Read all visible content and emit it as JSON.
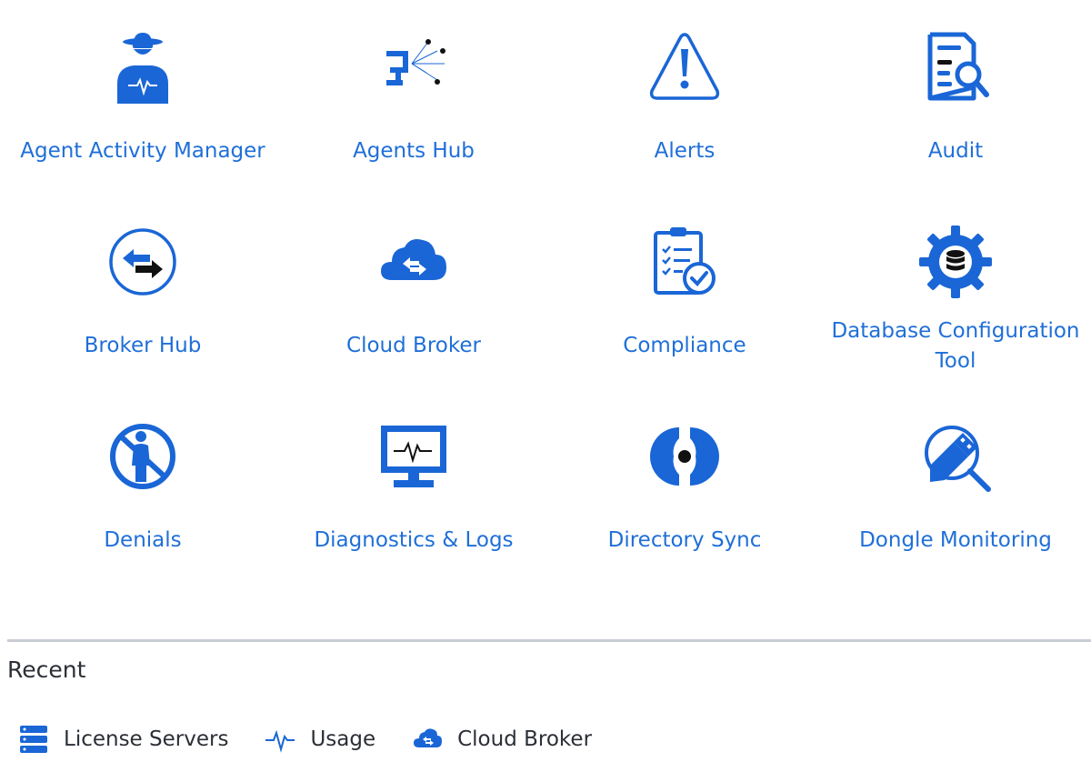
{
  "apps": [
    {
      "label": "Agent Activity Manager",
      "icon": "agent-spy-icon"
    },
    {
      "label": "Agents Hub",
      "icon": "network-monitor-icon"
    },
    {
      "label": "Alerts",
      "icon": "warning-triangle-icon"
    },
    {
      "label": "Audit",
      "icon": "document-search-icon"
    },
    {
      "label": "Broker Hub",
      "icon": "exchange-arrows-icon"
    },
    {
      "label": "Cloud Broker",
      "icon": "cloud-exchange-icon"
    },
    {
      "label": "Compliance",
      "icon": "clipboard-check-icon"
    },
    {
      "label": "Database Configuration Tool",
      "icon": "database-gear-icon"
    },
    {
      "label": "Denials",
      "icon": "no-person-icon"
    },
    {
      "label": "Diagnostics & Logs",
      "icon": "monitor-pulse-icon"
    },
    {
      "label": "Directory Sync",
      "icon": "sync-circle-icon"
    },
    {
      "label": "Dongle Monitoring",
      "icon": "usb-search-icon"
    }
  ],
  "recent": {
    "title": "Recent",
    "items": [
      {
        "label": "License Servers",
        "icon": "server-stack-icon"
      },
      {
        "label": "Usage",
        "icon": "pulse-icon"
      },
      {
        "label": "Cloud Broker",
        "icon": "cloud-exchange-icon"
      }
    ]
  },
  "colors": {
    "primary_blue": "#1f6fd8",
    "icon_blue": "#1a66d6",
    "text_dark": "#2b2f36",
    "divider": "#c9ccd4"
  }
}
